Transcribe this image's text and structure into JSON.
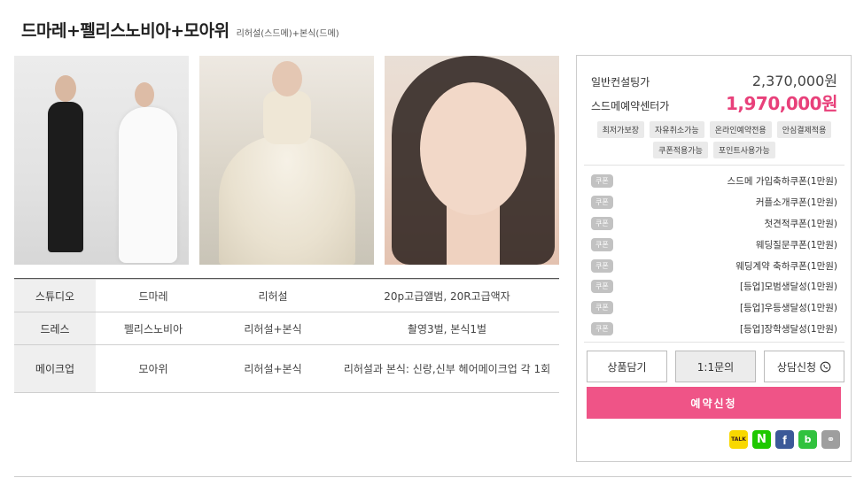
{
  "product": {
    "title": "드마레+펠리스노비아+모아위",
    "subtitle": "리허설(스드메)+본식(드메)"
  },
  "photos": [
    {
      "name": "couple-photo"
    },
    {
      "name": "wedding-dress-photo"
    },
    {
      "name": "bridal-makeup-photo"
    }
  ],
  "info_table": {
    "rows": [
      {
        "label": "스튜디오",
        "vendor": "드마레",
        "type": "리허설",
        "detail": "20p고급앨범, 20R고급액자"
      },
      {
        "label": "드레스",
        "vendor": "펠리스노비아",
        "type": "리허설+본식",
        "detail": "촬영3벌, 본식1벌"
      },
      {
        "label": "메이크업",
        "vendor": "모아위",
        "type": "리허설+본식",
        "detail": "리허설과 본식: 신랑,신부 헤어메이크업 각 1회"
      }
    ]
  },
  "panel": {
    "normal_label": "일반컨설팅가",
    "normal_price": "2,370,000원",
    "sale_label": "스드메예약센터가",
    "sale_price": "1,970,000원",
    "tags": [
      "최저가보장",
      "자유취소가능",
      "온라인예약전용",
      "안심결제적용",
      "쿠폰적용가능",
      "포인트사용가능"
    ],
    "coupon_badge": "쿠폰",
    "coupons": [
      "스드메 가입축하쿠폰(1만원)",
      "커플소개쿠폰(1만원)",
      "첫견적쿠폰(1만원)",
      "웨딩질문쿠폰(1만원)",
      "웨딩계약 축하쿠폰(1만원)",
      "[등업]모범생달성(1만원)",
      "[등업]우등생달성(1만원)",
      "[등업]장학생달성(1만원)"
    ],
    "buttons": {
      "wishlist": "상품담기",
      "inquiry": "1:1문의",
      "consult": "상담신청"
    },
    "reserve": "예약신청",
    "share": {
      "kakao": "TALK",
      "naver": "N",
      "facebook": "f",
      "band": "b",
      "link": "⚭"
    }
  },
  "colors": {
    "accent": "#ef5487",
    "sale_price": "#e8407a",
    "label_bg": "#efefef"
  }
}
